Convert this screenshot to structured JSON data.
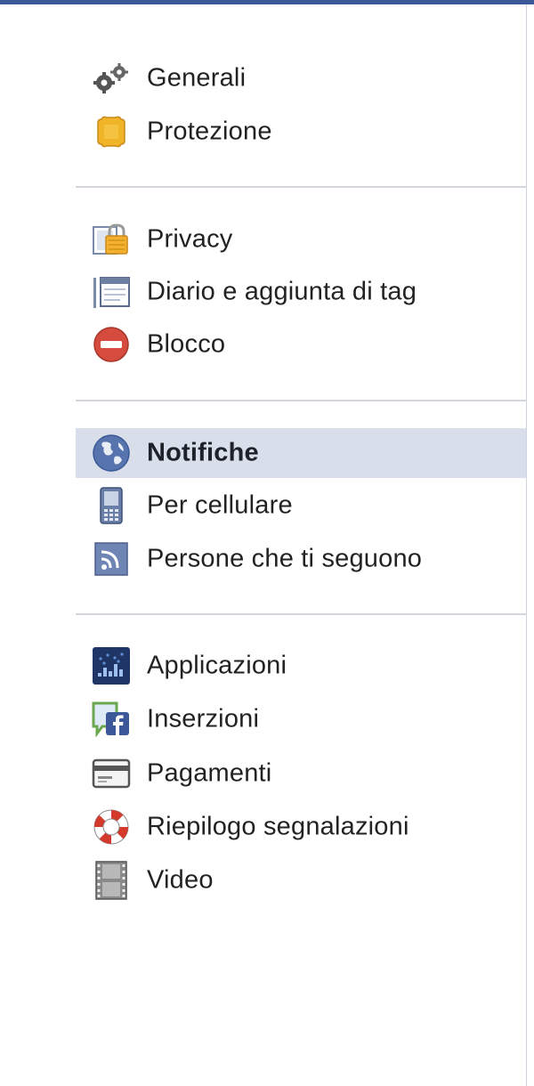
{
  "menu": {
    "groups": [
      {
        "items": [
          {
            "label": "Generali",
            "icon": "gears-icon"
          },
          {
            "label": "Protezione",
            "icon": "shield-badge-icon"
          }
        ]
      },
      {
        "items": [
          {
            "label": "Privacy",
            "icon": "padlock-icon"
          },
          {
            "label": "Diario e aggiunta di tag",
            "icon": "timeline-icon"
          },
          {
            "label": "Blocco",
            "icon": "block-icon"
          }
        ]
      },
      {
        "items": [
          {
            "label": "Notifiche",
            "icon": "globe-icon",
            "active": true
          },
          {
            "label": "Per cellulare",
            "icon": "mobile-phone-icon"
          },
          {
            "label": "Persone che ti seguono",
            "icon": "rss-feed-icon"
          }
        ]
      },
      {
        "items": [
          {
            "label": "Applicazioni",
            "icon": "apps-icon"
          },
          {
            "label": "Inserzioni",
            "icon": "facebook-ads-icon"
          },
          {
            "label": "Pagamenti",
            "icon": "credit-card-icon"
          },
          {
            "label": "Riepilogo segnalazioni",
            "icon": "lifebuoy-icon"
          },
          {
            "label": "Video",
            "icon": "film-strip-icon"
          }
        ]
      }
    ]
  },
  "colors": {
    "top_bar": "#3b5998",
    "active_background": "#d8dfea",
    "divider": "#d3d6db"
  }
}
